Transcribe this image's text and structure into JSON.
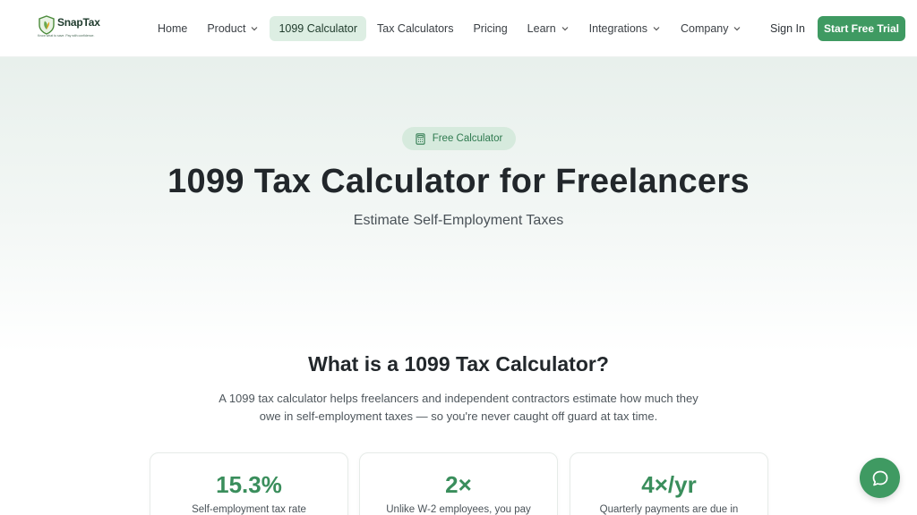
{
  "brand": {
    "name": "SnapTax",
    "tagline": "Know what to save. Pay with confidence.",
    "color": "#3f9a62"
  },
  "nav": {
    "items": [
      {
        "label": "Home",
        "has_dropdown": false,
        "active": false
      },
      {
        "label": "Product",
        "has_dropdown": true,
        "active": false
      },
      {
        "label": "1099 Calculator",
        "has_dropdown": false,
        "active": true
      },
      {
        "label": "Tax Calculators",
        "has_dropdown": false,
        "active": false
      },
      {
        "label": "Pricing",
        "has_dropdown": false,
        "active": false
      },
      {
        "label": "Learn",
        "has_dropdown": true,
        "active": false
      },
      {
        "label": "Integrations",
        "has_dropdown": true,
        "active": false
      },
      {
        "label": "Company",
        "has_dropdown": true,
        "active": false
      }
    ],
    "sign_in": "Sign In",
    "cta": "Start Free Trial"
  },
  "hero": {
    "badge": "Free Calculator",
    "badge_icon": "calculator-icon",
    "title": "1099 Tax Calculator for Freelancers",
    "subtitle": "Estimate Self-Employment Taxes"
  },
  "about": {
    "title": "What is a 1099 Tax Calculator?",
    "description": "A 1099 tax calculator helps freelancers and independent contractors estimate how much they owe in self-employment taxes — so you're never caught off guard at tax time."
  },
  "stats": [
    {
      "value": "15.3%",
      "label": "Self-employment tax rate"
    },
    {
      "value": "2×",
      "label": "Unlike W-2 employees, you pay"
    },
    {
      "value": "4×/yr",
      "label": "Quarterly payments are due in"
    }
  ],
  "chat": {
    "icon": "chat-bubble-icon"
  }
}
